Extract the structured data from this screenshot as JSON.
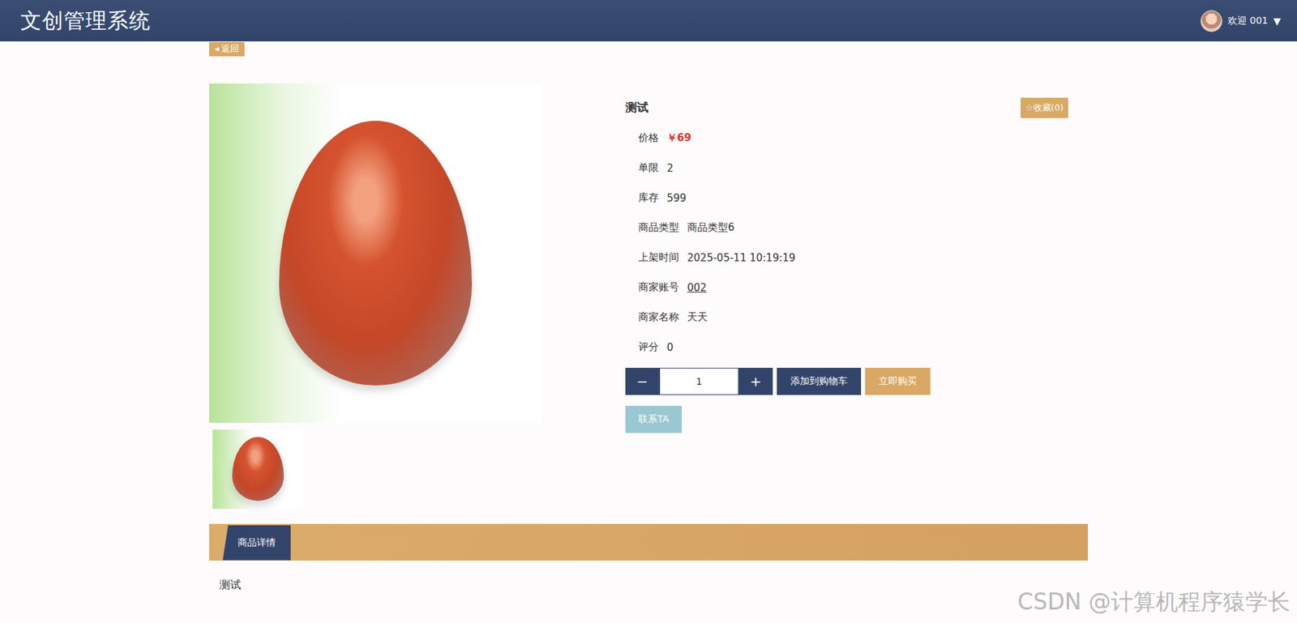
{
  "header": {
    "title": "文创管理系统",
    "user": "欢迎 001",
    "caret": "▼"
  },
  "back": {
    "icon": "◂",
    "label": "返回"
  },
  "product": {
    "title": "测试",
    "favorite": {
      "icon": "☆",
      "label": "收藏(0)"
    },
    "fields": [
      {
        "label": "价格",
        "value": "￥69",
        "kind": "price"
      },
      {
        "label": "单限",
        "value": "2",
        "kind": "text"
      },
      {
        "label": "库存",
        "value": "599",
        "kind": "text"
      },
      {
        "label": "商品类型",
        "value": "商品类型6",
        "kind": "text"
      },
      {
        "label": "上架时间",
        "value": "2025-05-11 10:19:19",
        "kind": "text"
      },
      {
        "label": "商家账号",
        "value": "002",
        "kind": "link"
      },
      {
        "label": "商家名称",
        "value": "天天",
        "kind": "text"
      },
      {
        "label": "评分",
        "value": "0",
        "kind": "text"
      }
    ],
    "quantity": {
      "minus": "−",
      "value": "1",
      "plus": "+"
    },
    "buttons": [
      {
        "label": "添加到购物车",
        "kind": "dark"
      },
      {
        "label": "立即购买",
        "kind": "gold"
      }
    ],
    "contact": "联系TA"
  },
  "tabs": [
    {
      "label": "商品详情",
      "selected": true
    }
  ],
  "detail": "测试",
  "watermark": "CSDN @计算机程序猿学长"
}
